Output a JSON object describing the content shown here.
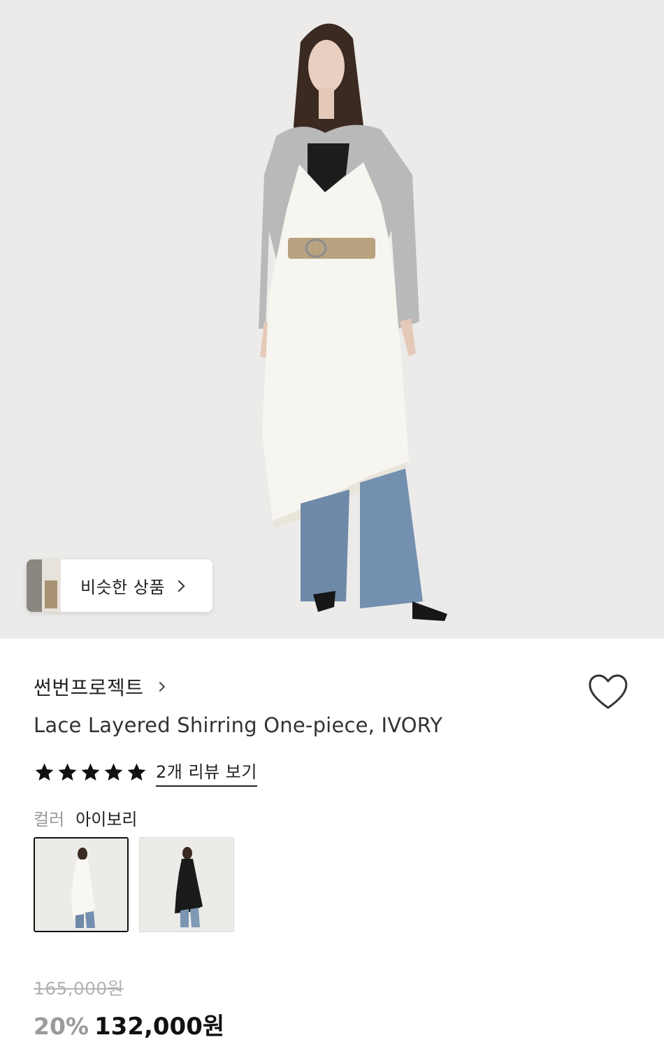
{
  "hero": {
    "image_alt": "model wearing ivory layered dress with grey cardigan, belt and jeans",
    "similar_products_label": "비슷한 상품",
    "similar_icon": "chevron-right-icon"
  },
  "brand": {
    "name": "썬번프로젝트",
    "chevron_icon": "chevron-right-icon"
  },
  "wishlist": {
    "icon": "heart-outline-icon"
  },
  "product": {
    "title": "Lace Layered Shirring One-piece, IVORY"
  },
  "rating": {
    "stars": 5,
    "max_stars": 5,
    "review_link": "2개 리뷰 보기"
  },
  "color": {
    "key": "컬러",
    "value": "아이보리",
    "options": [
      {
        "name": "ivory",
        "selected": true
      },
      {
        "name": "black",
        "selected": false
      }
    ]
  },
  "price": {
    "original": "165,000원",
    "discount": "20%",
    "sale": "132,000원"
  },
  "colors": {
    "background": "#ffffff",
    "hero_bg": "#ecebe9",
    "text": "#1a1a1a",
    "muted": "#9a9a9a",
    "strikethrough": "#b3b3b3"
  }
}
